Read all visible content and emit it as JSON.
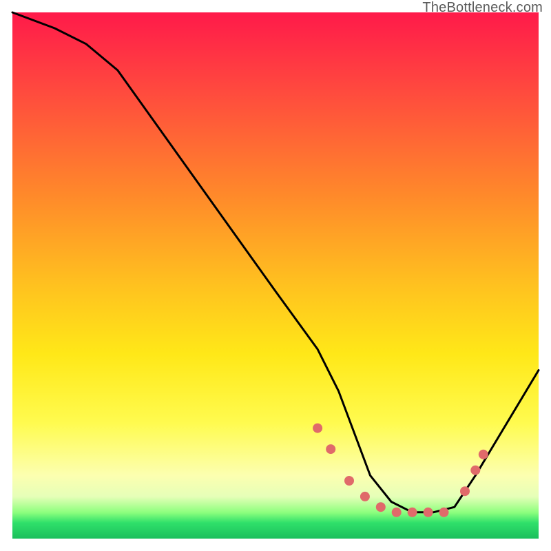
{
  "watermark": "TheBottleneck.com",
  "chart_data": {
    "type": "line",
    "title": "",
    "xlabel": "",
    "ylabel": "",
    "xlim": [
      0,
      100
    ],
    "ylim": [
      0,
      100
    ],
    "series": [
      {
        "name": "curve",
        "x": [
          0,
          8,
          14,
          20,
          30,
          40,
          50,
          58,
          62,
          65,
          68,
          72,
          76,
          80,
          84,
          88,
          100
        ],
        "values": [
          100,
          97,
          94,
          89,
          75,
          61,
          47,
          36,
          28,
          20,
          12,
          7,
          5,
          5,
          6,
          12,
          32
        ]
      }
    ],
    "markers": {
      "name": "dots",
      "color": "#e06a6a",
      "x": [
        58,
        60.5,
        64,
        67,
        70,
        73,
        76,
        79,
        82,
        86,
        88,
        89.5
      ],
      "values": [
        21,
        17,
        11,
        8,
        6,
        5,
        5,
        5,
        5,
        9,
        13,
        16
      ]
    },
    "background_gradient": {
      "stops": [
        {
          "pos": 0.0,
          "color": "#ff1a4a"
        },
        {
          "pos": 0.35,
          "color": "#ff8a2a"
        },
        {
          "pos": 0.65,
          "color": "#ffe818"
        },
        {
          "pos": 0.88,
          "color": "#fcffb0"
        },
        {
          "pos": 0.97,
          "color": "#2fe06a"
        },
        {
          "pos": 1.0,
          "color": "#1bbf5c"
        }
      ]
    }
  }
}
